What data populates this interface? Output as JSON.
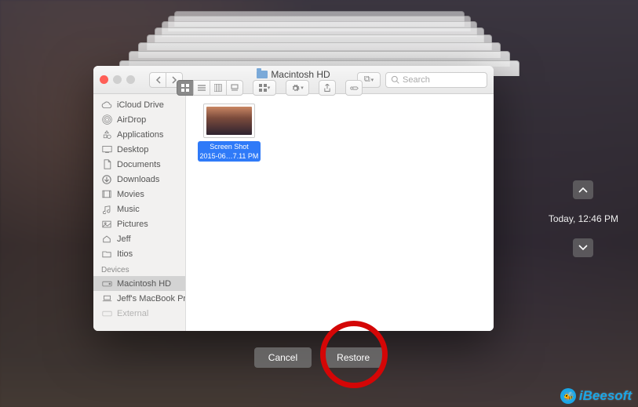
{
  "window": {
    "title": "Macintosh HD"
  },
  "toolbar": {
    "search_placeholder": "Search",
    "dropbox_icon": "dropbox-icon",
    "share_icon": "share-icon",
    "tag_icon": "tag-icon",
    "action_icon": "gear-icon",
    "arrange_icon": "arrange-icon"
  },
  "sidebar": {
    "favorites": [
      {
        "label": "iCloud Drive",
        "icon": "cloud-icon"
      },
      {
        "label": "AirDrop",
        "icon": "airdrop-icon"
      },
      {
        "label": "Applications",
        "icon": "apps-icon"
      },
      {
        "label": "Desktop",
        "icon": "desktop-icon"
      },
      {
        "label": "Documents",
        "icon": "documents-icon"
      },
      {
        "label": "Downloads",
        "icon": "downloads-icon"
      },
      {
        "label": "Movies",
        "icon": "movies-icon"
      },
      {
        "label": "Music",
        "icon": "music-icon"
      },
      {
        "label": "Pictures",
        "icon": "pictures-icon"
      },
      {
        "label": "Jeff",
        "icon": "home-icon"
      },
      {
        "label": "Itios",
        "icon": "folder-icon"
      }
    ],
    "devices_header": "Devices",
    "devices": [
      {
        "label": "Macintosh HD",
        "icon": "disk-icon",
        "selected": true
      },
      {
        "label": "Jeff's MacBook Pr…",
        "icon": "laptop-icon"
      },
      {
        "label": "External",
        "icon": "disk-icon"
      }
    ]
  },
  "file": {
    "name_line1": "Screen Shot",
    "name_line2": "2015-06…7.11 PM"
  },
  "timeline": {
    "label": "Today, 12:46 PM"
  },
  "buttons": {
    "cancel": "Cancel",
    "restore": "Restore"
  },
  "watermark": "iBeesoft"
}
